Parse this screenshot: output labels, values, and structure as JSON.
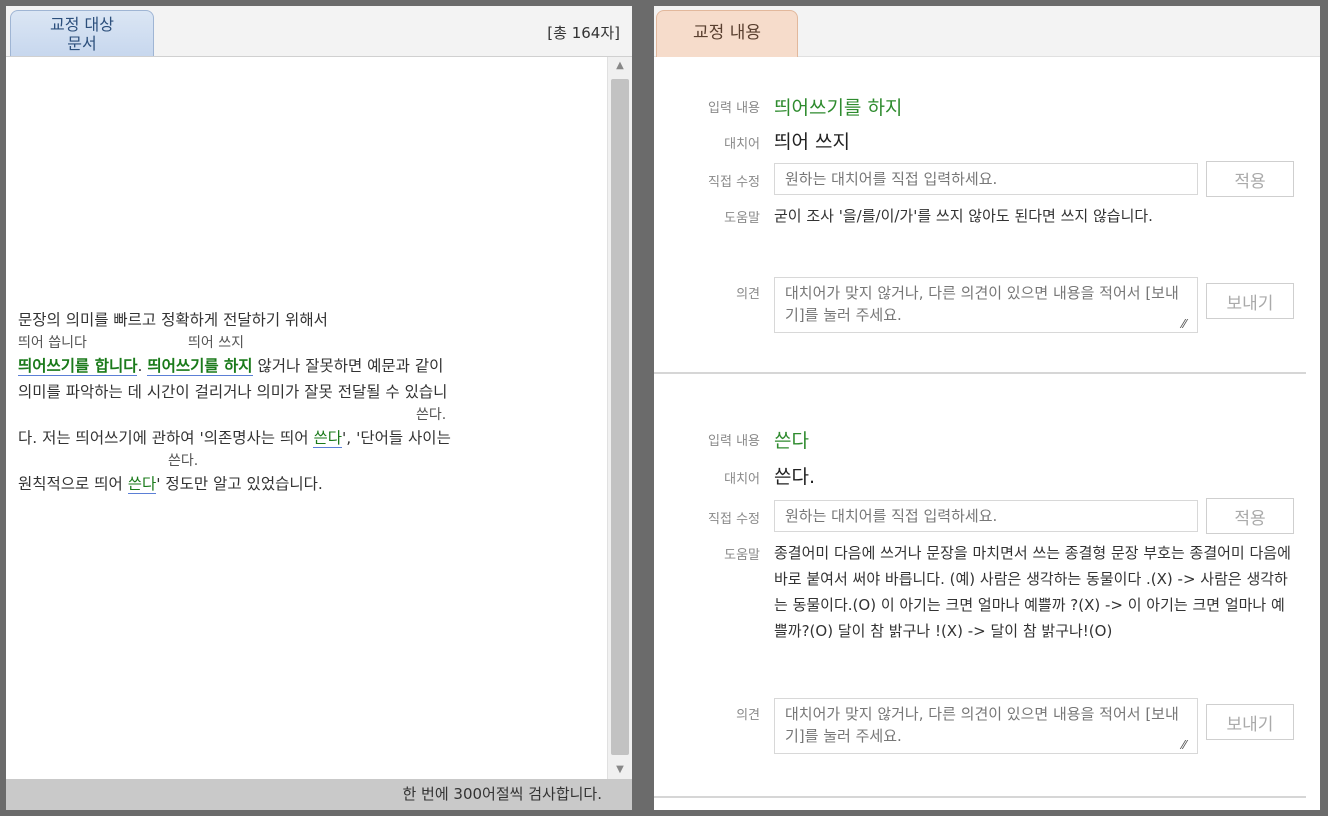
{
  "left": {
    "tab_label": "교정 대상\n문서",
    "char_count": "[총 164자]",
    "status": "한 번에 300어절씩 검사합니다.",
    "lines": {
      "l1": "문장의 의미를 빠르고 정확하게 전달하기 위해서",
      "sug1a": "띄어 씁니다",
      "sug1b": "띄어 쓰지",
      "err1": "띄어쓰기를 합니다",
      "p1": ". ",
      "err2": "띄어쓰기를 하지",
      "p2": " 않거나 잘못하면 예문과 같이",
      "l4": "의미를 파악하는 데 시간이 걸리거나 의미가 잘못 전달될 수 있습니",
      "sug2": "쓴다.",
      "l5a": "다. 저는 띄어쓰기에 관하여 '의존명사는 띄어 ",
      "err3": "쓴다",
      "l5b": "', '단어들 사이는",
      "sug3": "쓴다.",
      "l6a": "원칙적으로 띄어 ",
      "err4": "쓴다",
      "l6b": "' 정도만 알고 있었습니다."
    }
  },
  "right": {
    "tab_label": "교정 내용",
    "labels": {
      "input": "입력 내용",
      "replace": "대치어",
      "direct": "직접 수정",
      "help": "도움말",
      "opinion": "의견"
    },
    "cards": [
      {
        "input": "띄어쓰기를 하지",
        "replace": "띄어 쓰지",
        "direct_placeholder": "원하는 대치어를 직접 입력하세요.",
        "apply": "적용",
        "help": "굳이 조사 '을/를/이/가'를 쓰지 않아도 된다면 쓰지 않습니다.",
        "opinion_placeholder": "대치어가 맞지 않거나, 다른 의견이 있으면 내용을 적어서 [보내기]를 눌러 주세요.",
        "send": "보내기"
      },
      {
        "input": "쓴다",
        "replace": "쓴다.",
        "direct_placeholder": "원하는 대치어를 직접 입력하세요.",
        "apply": "적용",
        "help": "종결어미 다음에 쓰거나 문장을 마치면서 쓰는 종결형 문장 부호는 종결어미 다음에 바로 붙여서 써야 바릅니다. (예) 사람은 생각하는 동물이다 .(X) -> 사람은 생각하는 동물이다.(O) 이 아기는 크면 얼마나 예쁠까 ?(X) -> 이 아기는 크면 얼마나 예쁠까?(O) 달이 참 밝구나 !(X) -> 달이 참 밝구나!(O)",
        "opinion_placeholder": "대치어가 맞지 않거나, 다른 의견이 있으면 내용을 적어서 [보내기]를 눌러 주세요.",
        "send": "보내기"
      }
    ]
  },
  "colors": {
    "accent_green": "#2e8b2e",
    "left_tab": "#c7d7ee",
    "right_tab": "#f6dccb",
    "underline": "#5b7fd6"
  }
}
